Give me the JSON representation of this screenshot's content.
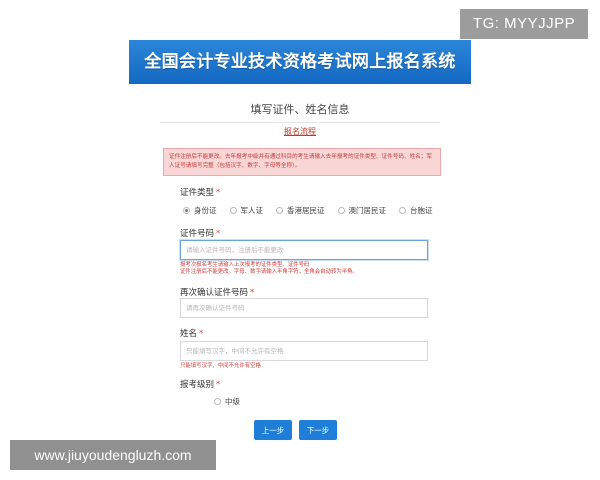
{
  "watermarks": {
    "tg": "TG: MYYJJPP",
    "url": "www.jiuyoudengluzh.com"
  },
  "banner": {
    "title": "全国会计专业技术资格考试网上报名系统"
  },
  "page": {
    "title": "填写证件、姓名信息",
    "process_link": "报名流程"
  },
  "alert": {
    "text": "证件注册后不能更改。去年报考中级并有通过科目的考生请输入去年报考的证件类型、证件号码、姓名；军人证号请填写完整（包括汉字、数字、字母等全称）。"
  },
  "form": {
    "id_type": {
      "label": "证件类型",
      "required_mark": "*",
      "options": [
        "身份证",
        "军人证",
        "香港居民证",
        "澳门居民证",
        "台胞证"
      ],
      "selected": "身份证"
    },
    "id_number": {
      "label": "证件号码",
      "required_mark": "*",
      "placeholder": "请输入证件号码，注册后不能更改",
      "hint_line1": "报考次报名考生请输入上次报考的证件类型、证件号码",
      "hint_line2": "证件注册后不能更改。字母、数字请输入半角字符，全角会自动转为半角。"
    },
    "id_confirm": {
      "label": "再次确认证件号码",
      "required_mark": "*",
      "placeholder": "请再次确认证件号码"
    },
    "name": {
      "label": "姓名",
      "required_mark": "*",
      "placeholder": "只能填写汉字，中间不允许有空格",
      "hint": "只能填写汉字，中间不允许有空格"
    },
    "level": {
      "label": "报考级别",
      "required_mark": "*",
      "options": [
        "中级"
      ]
    }
  },
  "buttons": {
    "prev": "上一步",
    "next": "下一步"
  },
  "colors": {
    "banner_blue": "#1f78d1",
    "required_red": "#d9534f",
    "alert_bg": "#f9d6d6",
    "button_blue": "#1f7fd8"
  }
}
